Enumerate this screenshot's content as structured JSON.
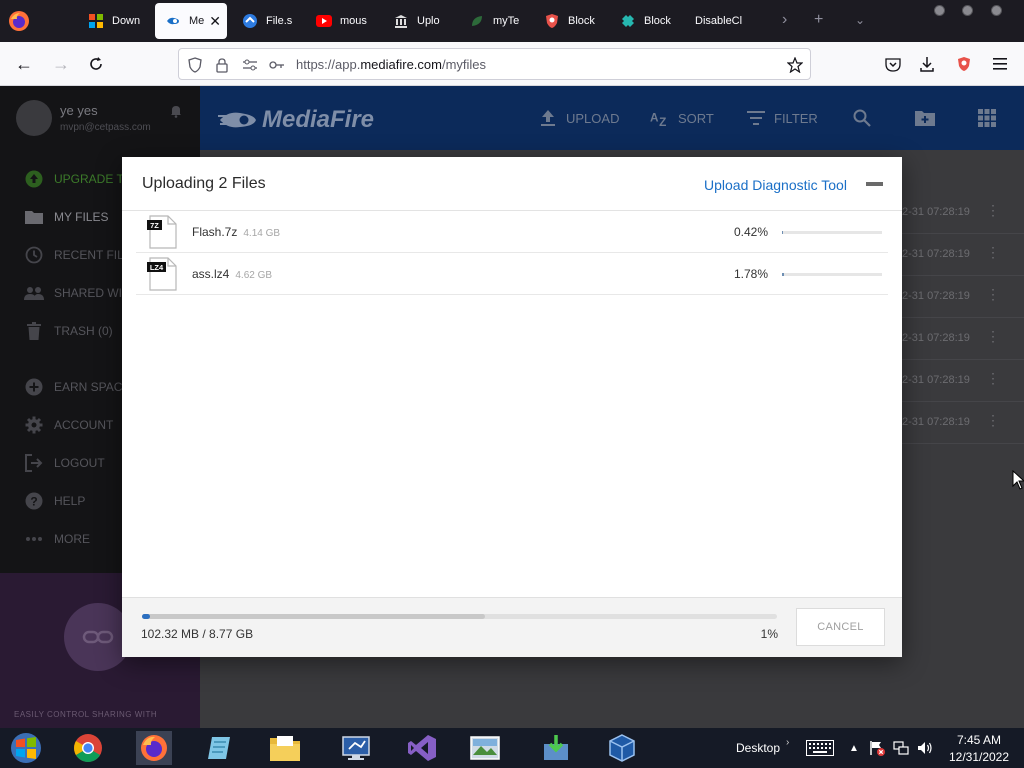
{
  "browser": {
    "tabs": [
      {
        "label": "Down",
        "icon": "windows-logo-icon"
      },
      {
        "label": "Me",
        "icon": "mediafire-icon",
        "active": true
      },
      {
        "label": "File.s",
        "icon": "file-share-icon"
      },
      {
        "label": "mous",
        "icon": "youtube-icon"
      },
      {
        "label": "Uplo",
        "icon": "museum-icon"
      },
      {
        "label": "myTe",
        "icon": "leaf-icon"
      },
      {
        "label": "Block",
        "icon": "shield-icon"
      },
      {
        "label": "Block",
        "icon": "puzzle-icon"
      },
      {
        "label": "DisableCl",
        "icon": "blank-icon"
      }
    ],
    "url_prefix": "https://app.",
    "url_domain": "mediafire.com",
    "url_path": "/myfiles"
  },
  "sidebar": {
    "user_name": "ye yes",
    "user_email": "mvpn@cetpass.com",
    "items": [
      {
        "label": "UPGRADE T",
        "icon": "upgrade-icon"
      },
      {
        "label": "MY FILES",
        "icon": "folder-icon"
      },
      {
        "label": "RECENT FIL",
        "icon": "clock-icon"
      },
      {
        "label": "SHARED WI",
        "icon": "people-icon"
      },
      {
        "label": "TRASH (0)",
        "icon": "trash-icon"
      },
      {
        "label": "EARN SPAC",
        "icon": "plus-circle-icon"
      },
      {
        "label": "ACCOUNT",
        "icon": "gear-icon"
      },
      {
        "label": "LOGOUT",
        "icon": "logout-icon"
      },
      {
        "label": "HELP",
        "icon": "help-icon"
      },
      {
        "label": "MORE",
        "icon": "more-dots-icon"
      }
    ],
    "promo_text": "EASILY CONTROL SHARING WITH"
  },
  "header": {
    "logo_text": "MediaFire",
    "upload": "UPLOAD",
    "sort": "SORT",
    "filter": "FILTER"
  },
  "file_dates": [
    "2-31 07:28:19",
    "2-31 07:28:19",
    "2-31 07:28:19",
    "2-31 07:28:19",
    "2-31 07:28:19",
    "2-31 07:28:19"
  ],
  "dialog": {
    "title": "Uploading 2 Files",
    "diagnostic_link": "Upload Diagnostic Tool",
    "files": [
      {
        "name": "Flash.7z",
        "size": "4.14 GB",
        "badge": "7Z",
        "percent": "0.42%",
        "progress": 0.0042
      },
      {
        "name": "ass.lz4",
        "size": "4.62 GB",
        "badge": "LZ4",
        "percent": "1.78%",
        "progress": 0.0178
      }
    ],
    "total_text": "102.32 MB / 8.77 GB",
    "total_percent": "1%",
    "total_progress": 0.01,
    "cancel_label": "CANCEL"
  },
  "taskbar": {
    "desktop_label": "Desktop",
    "time": "7:45 AM",
    "date": "12/31/2022"
  },
  "colors": {
    "accent_blue": "#1a6fc7",
    "progress_blue": "#2c6fc0",
    "mediafire_header": "#0c2a5a",
    "firefox_tabstrip": "#1c1b22"
  }
}
